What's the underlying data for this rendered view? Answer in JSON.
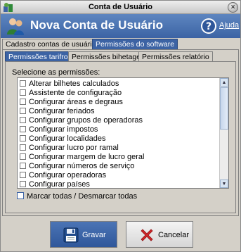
{
  "window": {
    "title": "Conta de Usuário",
    "close_glyph": "×"
  },
  "banner": {
    "title": "Nova Conta de Usuário",
    "help_label": "Ajuda"
  },
  "tabs": [
    {
      "label": "Cadastro contas de usuários",
      "active": false
    },
    {
      "label": "Permissões do software",
      "active": true
    }
  ],
  "subtabs": [
    {
      "label": "Permissões tarifron",
      "active": true
    },
    {
      "label": "Permissões bihetagem",
      "active": false
    },
    {
      "label": "Permissões  relatório",
      "active": false
    }
  ],
  "permissions": {
    "group_label": "Selecione as permissões:",
    "items": [
      {
        "label": "Alterar bilhetes calculados",
        "checked": false
      },
      {
        "label": "Assistente de configuração",
        "checked": false
      },
      {
        "label": "Configurar áreas e degraus",
        "checked": false
      },
      {
        "label": "Configurar feriados",
        "checked": false
      },
      {
        "label": "Configurar grupos de operadoras",
        "checked": false
      },
      {
        "label": "Configurar impostos",
        "checked": false
      },
      {
        "label": "Configurar localidades",
        "checked": false
      },
      {
        "label": "Configurar lucro por ramal",
        "checked": false
      },
      {
        "label": "Configurar margem de lucro geral",
        "checked": false
      },
      {
        "label": "Configurar números de serviço",
        "checked": false
      },
      {
        "label": "Configurar operadoras",
        "checked": false
      },
      {
        "label": "Configurar países",
        "checked": false
      }
    ],
    "select_all_label": "Marcar todas / Desmarcar todas"
  },
  "buttons": {
    "save_label": "Gravar",
    "cancel_label": "Cancelar"
  },
  "icons": {
    "app": "app-icon",
    "banner": "user-accounts-icon",
    "help": "help-icon",
    "save": "floppy-disk-icon",
    "cancel": "cancel-x-icon"
  },
  "colors": {
    "accent": "#3c63a4",
    "window_bg": "#d4d0c8",
    "cancel_red": "#d2262a"
  }
}
